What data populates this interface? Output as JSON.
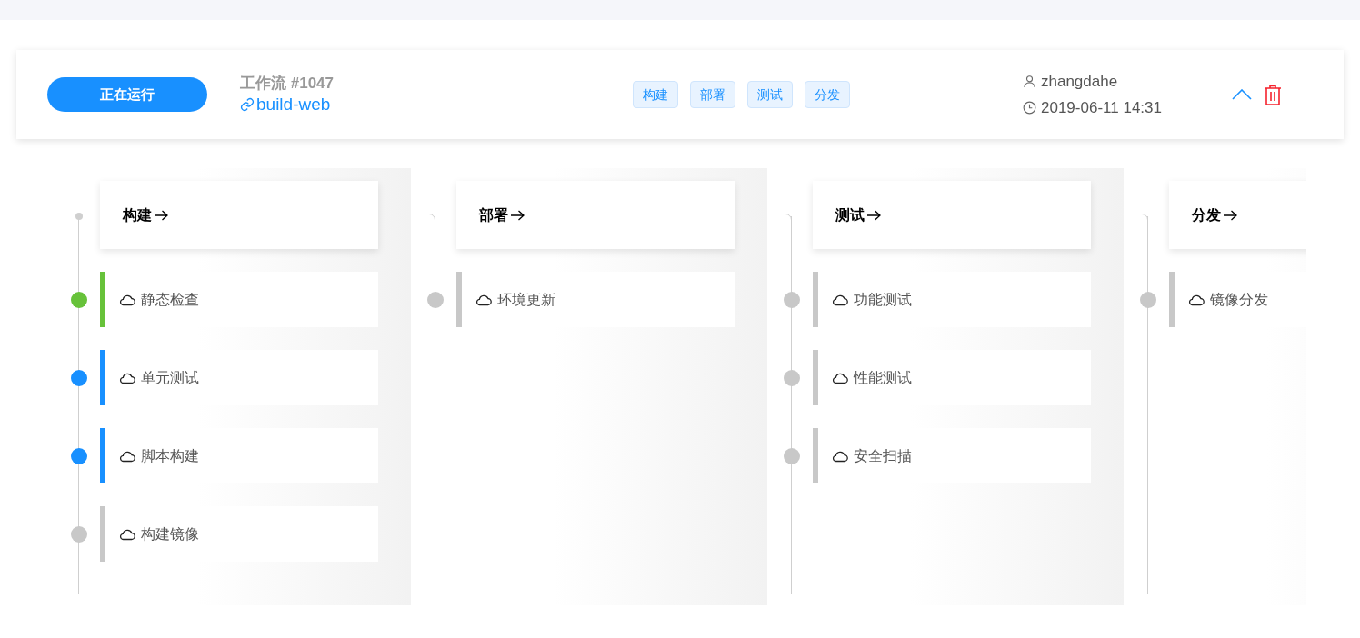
{
  "pipeline": {
    "status_button": "正在运行",
    "workflow_label": "工作流 #1047",
    "link": "build-web",
    "tags": [
      "构建",
      "部署",
      "测试",
      "分发"
    ],
    "user": "zhangdahe",
    "time": "2019-06-11 14:31",
    "expanded": true
  },
  "stages": [
    {
      "title": "构建",
      "jobs": [
        {
          "name": "静态检查",
          "color": "#67c23a"
        },
        {
          "name": "单元测试",
          "color": "#1890ff"
        },
        {
          "name": "脚本构建",
          "color": "#1890ff"
        },
        {
          "name": "构建镜像",
          "color": "#c8c8c8"
        }
      ]
    },
    {
      "title": "部署",
      "jobs": [
        {
          "name": "环境更新",
          "color": "#c8c8c8"
        }
      ]
    },
    {
      "title": "测试",
      "jobs": [
        {
          "name": "功能测试",
          "color": "#c8c8c8"
        },
        {
          "name": "性能测试",
          "color": "#c8c8c8"
        },
        {
          "name": "安全扫描",
          "color": "#c8c8c8"
        }
      ]
    },
    {
      "title": "分发",
      "jobs": [
        {
          "name": "镜像分发",
          "color": "#c8c8c8"
        }
      ]
    }
  ]
}
